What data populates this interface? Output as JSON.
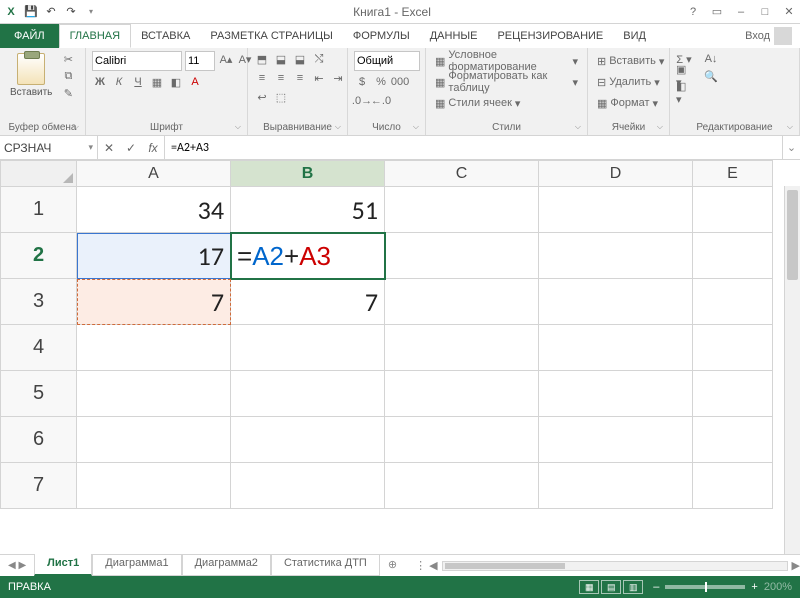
{
  "titlebar": {
    "title": "Книга1 - Excel"
  },
  "tabs": {
    "file": "ФАЙЛ",
    "items": [
      "ГЛАВНАЯ",
      "ВСТАВКА",
      "РАЗМЕТКА СТРАНИЦЫ",
      "ФОРМУЛЫ",
      "ДАННЫЕ",
      "РЕЦЕНЗИРОВАНИЕ",
      "ВИД"
    ],
    "active_index": 0,
    "login": "Вход"
  },
  "ribbon": {
    "clipboard": {
      "paste": "Вставить",
      "label": "Буфер обмена"
    },
    "font": {
      "name": "Calibri",
      "size": "11",
      "label": "Шрифт",
      "bold": "Ж",
      "italic": "К",
      "underline": "Ч"
    },
    "alignment": {
      "label": "Выравнивание"
    },
    "number": {
      "format": "Общий",
      "label": "Число"
    },
    "styles": {
      "cond": "Условное форматирование",
      "table": "Форматировать как таблицу",
      "cell": "Стили ячеек",
      "label": "Стили"
    },
    "cells": {
      "insert": "Вставить",
      "delete": "Удалить",
      "format": "Формат",
      "label": "Ячейки"
    },
    "editing": {
      "label": "Редактирование"
    }
  },
  "formula": {
    "namebox": "СРЗНАЧ",
    "value": "=A2+A3"
  },
  "grid": {
    "cols": [
      "A",
      "B",
      "C",
      "D",
      "E"
    ],
    "active_col": "B",
    "rows": [
      1,
      2,
      3,
      4,
      5,
      6,
      7
    ],
    "active_row": 2,
    "cells": {
      "A1": "34",
      "B1": "51",
      "A2": "17",
      "B2_prefix": "=",
      "B2_ref1": "A2",
      "B2_plus": "+",
      "B2_ref2": "A3",
      "A3": "7",
      "B3": "7"
    }
  },
  "sheets": {
    "tabs": [
      "Лист1",
      "Диаграмма1",
      "Диаграмма2",
      "Статистика ДТП"
    ],
    "active_index": 0
  },
  "status": {
    "mode": "ПРАВКА",
    "zoom": "200%"
  }
}
